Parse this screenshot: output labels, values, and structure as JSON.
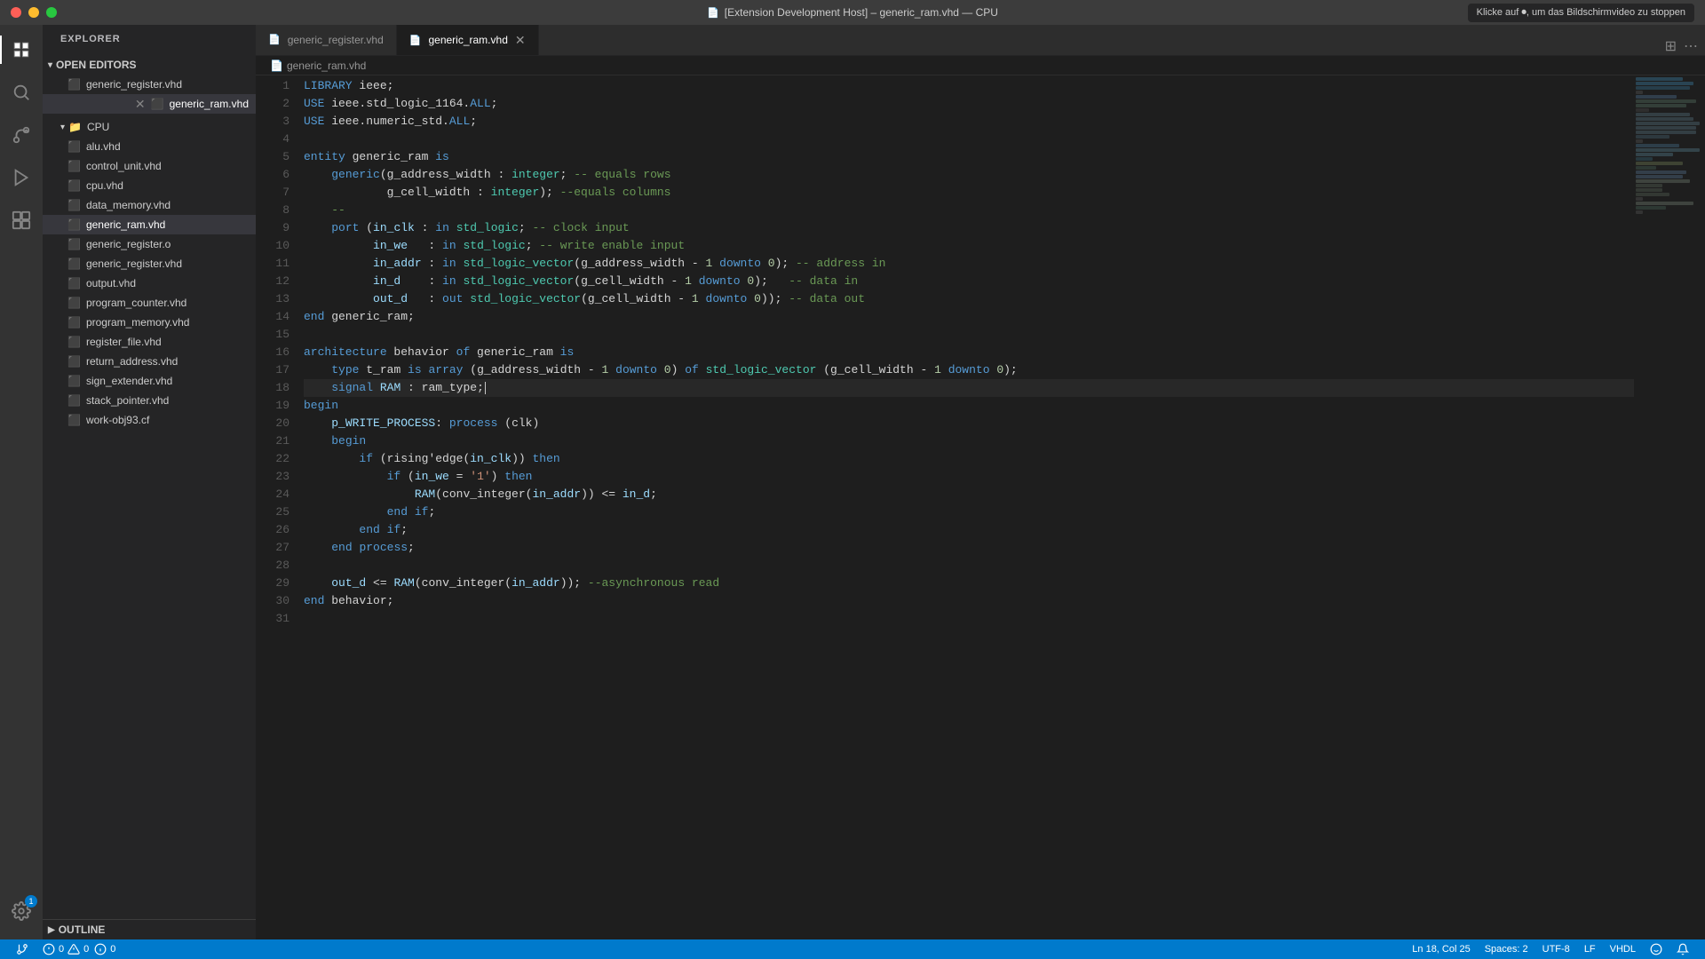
{
  "titlebar": {
    "title": "[Extension Development Host] – generic_ram.vhd — CPU",
    "notification": "Klicke auf ⏺, um das Bildschirmvideo zu stoppen"
  },
  "tabs": [
    {
      "id": "generic_register",
      "label": "generic_register.vhd",
      "active": false,
      "modified": false
    },
    {
      "id": "generic_ram",
      "label": "generic_ram.vhd",
      "active": true,
      "modified": false
    }
  ],
  "breadcrumb": {
    "items": [
      "generic_ram.vhd"
    ]
  },
  "sidebar": {
    "title": "EXPLORER",
    "open_editors_label": "OPEN EDITORS",
    "open_editors": [
      {
        "name": "generic_register.vhd",
        "modified": false
      },
      {
        "name": "generic_ram.vhd",
        "modified": true
      }
    ],
    "cpu_label": "CPU",
    "files": [
      "alu.vhd",
      "control_unit.vhd",
      "cpu.vhd",
      "data_memory.vhd",
      "generic_ram.vhd",
      "generic_register.o",
      "generic_register.vhd",
      "output.vhd",
      "program_counter.vhd",
      "program_memory.vhd",
      "register_file.vhd",
      "return_address.vhd",
      "sign_extender.vhd",
      "stack_pointer.vhd",
      "work-obj93.cf"
    ],
    "outline_label": "OUTLINE"
  },
  "editor": {
    "lines": [
      {
        "num": 1,
        "text": "LIBRARY ieee;"
      },
      {
        "num": 2,
        "text": "USE ieee.std_logic_1164.ALL;"
      },
      {
        "num": 3,
        "text": "USE ieee.numeric_std.ALL;"
      },
      {
        "num": 4,
        "text": ""
      },
      {
        "num": 5,
        "text": "entity generic_ram is"
      },
      {
        "num": 6,
        "text": "    generic(g_address_width : integer; -- equals rows"
      },
      {
        "num": 7,
        "text": "            g_cell_width : integer); --equals columns"
      },
      {
        "num": 8,
        "text": "    --"
      },
      {
        "num": 9,
        "text": "    port (in_clk : in std_logic; -- clock input"
      },
      {
        "num": 10,
        "text": "          in_we   : in std_logic; -- write enable input"
      },
      {
        "num": 11,
        "text": "          in_addr : in std_logic_vector(g_address_width - 1 downto 0); -- address in"
      },
      {
        "num": 12,
        "text": "          in_d    : in std_logic_vector(g_cell_width - 1 downto 0);   -- data in"
      },
      {
        "num": 13,
        "text": "          out_d   : out std_logic_vector(g_cell_width - 1 downto 0)); -- data out"
      },
      {
        "num": 14,
        "text": "end generic_ram;"
      },
      {
        "num": 15,
        "text": ""
      },
      {
        "num": 16,
        "text": "architecture behavior of generic_ram is"
      },
      {
        "num": 17,
        "text": "    type t_ram is array (g_address_width - 1 downto 0) of std_logic_vector (g_cell_width - 1 downto 0);"
      },
      {
        "num": 18,
        "text": "    signal RAM : ram_type;",
        "active": true
      },
      {
        "num": 19,
        "text": "begin"
      },
      {
        "num": 20,
        "text": "    p_WRITE_PROCESS: process (clk)"
      },
      {
        "num": 21,
        "text": "    begin"
      },
      {
        "num": 22,
        "text": "        if (rising'edge(in_clk)) then"
      },
      {
        "num": 23,
        "text": "            if (in_we = '1') then"
      },
      {
        "num": 24,
        "text": "                RAM(conv_integer(in_addr)) <= in_d;"
      },
      {
        "num": 25,
        "text": "            end if;"
      },
      {
        "num": 26,
        "text": "        end if;"
      },
      {
        "num": 27,
        "text": "    end process;"
      },
      {
        "num": 28,
        "text": ""
      },
      {
        "num": 29,
        "text": "    out_d <= RAM(conv_integer(in_addr)); --asynchronous read"
      },
      {
        "num": 30,
        "text": "end behavior;"
      },
      {
        "num": 31,
        "text": ""
      }
    ]
  },
  "statusbar": {
    "errors": "0",
    "warnings": "0",
    "info": "0",
    "ln": "Ln 18, Col 25",
    "spaces": "Spaces: 2",
    "encoding": "UTF-8",
    "eol": "LF",
    "language": "VHDL"
  }
}
